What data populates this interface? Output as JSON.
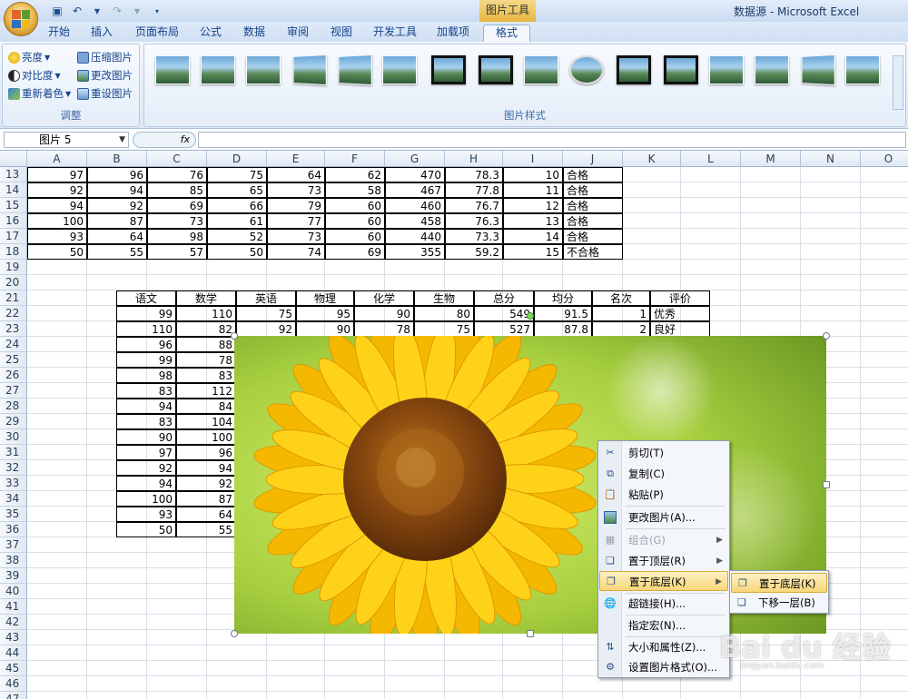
{
  "window": {
    "title": "数据源 - Microsoft Excel",
    "contextual_tab_group": "图片工具"
  },
  "tabs": [
    "开始",
    "插入",
    "页面布局",
    "公式",
    "数据",
    "审阅",
    "视图",
    "开发工具",
    "加载项",
    "格式"
  ],
  "active_tab": "格式",
  "ribbon": {
    "adjust_group": {
      "label": "调整",
      "buttons": [
        "亮度",
        "对比度",
        "重新着色",
        "压缩图片",
        "更改图片",
        "重设图片"
      ]
    },
    "picture_styles_group": {
      "label": "图片样式"
    }
  },
  "formula_bar": {
    "name_box": "图片 5",
    "fx": "fx",
    "value": ""
  },
  "columns": [
    "A",
    "B",
    "C",
    "D",
    "E",
    "F",
    "G",
    "H",
    "I",
    "J",
    "K",
    "L",
    "M",
    "N",
    "O"
  ],
  "rows": [
    "13",
    "14",
    "15",
    "16",
    "17",
    "18",
    "19",
    "20",
    "21",
    "22",
    "23",
    "24",
    "25",
    "26",
    "27",
    "28",
    "29",
    "30",
    "31",
    "32",
    "33",
    "34",
    "35",
    "36",
    "37",
    "38",
    "39",
    "40",
    "41",
    "42",
    "43",
    "44",
    "45",
    "46",
    "47"
  ],
  "upper_table": [
    [
      "97",
      "96",
      "76",
      "75",
      "64",
      "62",
      "470",
      "78.3",
      "10",
      "合格"
    ],
    [
      "92",
      "94",
      "85",
      "65",
      "73",
      "58",
      "467",
      "77.8",
      "11",
      "合格"
    ],
    [
      "94",
      "92",
      "69",
      "66",
      "79",
      "60",
      "460",
      "76.7",
      "12",
      "合格"
    ],
    [
      "100",
      "87",
      "73",
      "61",
      "77",
      "60",
      "458",
      "76.3",
      "13",
      "合格"
    ],
    [
      "93",
      "64",
      "98",
      "52",
      "73",
      "60",
      "440",
      "73.3",
      "14",
      "合格"
    ],
    [
      "50",
      "55",
      "57",
      "50",
      "74",
      "69",
      "355",
      "59.2",
      "15",
      "不合格"
    ]
  ],
  "lower_table": {
    "headers": [
      "语文",
      "数学",
      "英语",
      "物理",
      "化学",
      "生物",
      "总分",
      "均分",
      "名次",
      "评价"
    ],
    "row22": [
      "99",
      "110",
      "75",
      "95",
      "90",
      "80",
      "549",
      "91.5",
      "1",
      "优秀"
    ],
    "row23": [
      "110",
      "82",
      "92",
      "90",
      "78",
      "75",
      "527",
      "87.8",
      "2",
      "良好"
    ],
    "col_values": [
      [
        "96",
        "88"
      ],
      [
        "99",
        "78"
      ],
      [
        "98",
        "83"
      ],
      [
        "83",
        "112"
      ],
      [
        "94",
        "84"
      ],
      [
        "83",
        "104"
      ],
      [
        "90",
        "100"
      ],
      [
        "97",
        "96"
      ],
      [
        "92",
        "94"
      ],
      [
        "94",
        "92"
      ],
      [
        "100",
        "87"
      ],
      [
        "93",
        "64"
      ],
      [
        "50",
        "55"
      ]
    ]
  },
  "context_menu": {
    "items": [
      {
        "label": "剪切(T)",
        "icon": "scissors-icon"
      },
      {
        "label": "复制(C)",
        "icon": "copy-icon"
      },
      {
        "label": "粘贴(P)",
        "icon": "paste-icon"
      },
      {
        "label": "更改图片(A)...",
        "icon": "change-picture-icon"
      },
      {
        "label": "组合(G)",
        "icon": "group-icon"
      },
      {
        "label": "置于顶层(R)",
        "icon": "bring-to-front-icon"
      },
      {
        "label": "置于底层(K)",
        "icon": "send-to-back-icon"
      },
      {
        "label": "超链接(H)...",
        "icon": "hyperlink-icon"
      },
      {
        "label": "指定宏(N)...",
        "icon": ""
      },
      {
        "label": "大小和属性(Z)...",
        "icon": "size-properties-icon"
      },
      {
        "label": "设置图片格式(O)...",
        "icon": "format-picture-icon"
      }
    ],
    "submenu": [
      "置于底层(K)",
      "下移一层(B)"
    ]
  },
  "watermark": {
    "brand": "Bai du 经验",
    "url": "jingyan.baidu.com"
  }
}
